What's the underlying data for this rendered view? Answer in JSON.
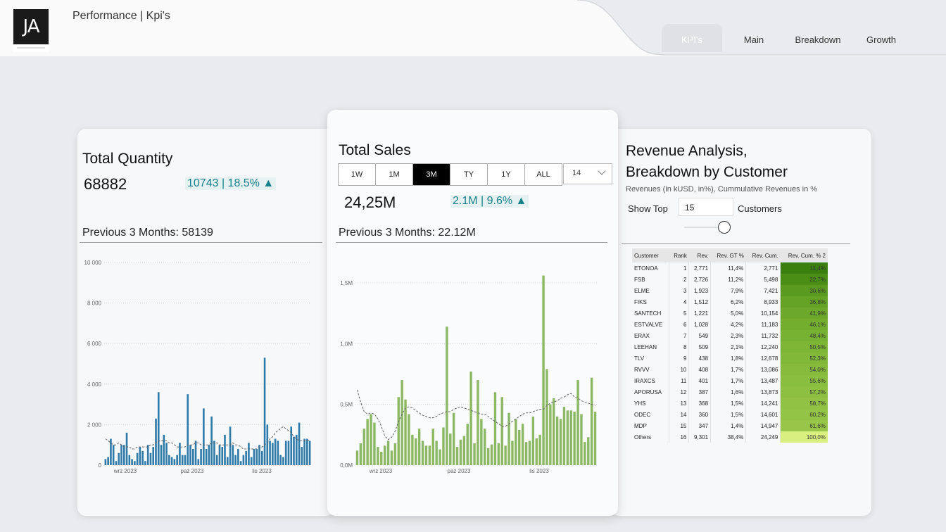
{
  "header": {
    "logo_text": "JA",
    "page_title": "Performance | Kpi's",
    "tabs": [
      {
        "label": "KPI's",
        "active": true
      },
      {
        "label": "Main",
        "active": false
      },
      {
        "label": "Breakdown",
        "active": false
      },
      {
        "label": "Growth",
        "active": false
      }
    ]
  },
  "quantity": {
    "title": "Total Quantity",
    "value": "68882",
    "delta": "10743 | 18.5% ▲",
    "previous": "Previous 3 Months: 58139"
  },
  "sales": {
    "title": "Total Sales",
    "periods": [
      {
        "label": "1W",
        "selected": false
      },
      {
        "label": "1M",
        "selected": false
      },
      {
        "label": "3M",
        "selected": true
      },
      {
        "label": "TY",
        "selected": false
      },
      {
        "label": "1Y",
        "selected": false
      },
      {
        "label": "ALL",
        "selected": false
      }
    ],
    "dropdown_value": "14",
    "value": "24,25M",
    "delta": "2.1M | 9.6% ▲",
    "previous": "Previous 3 Months: 22.12M"
  },
  "revenue": {
    "title_line1": "Revenue Analysis,",
    "title_line2": "Breakdown by Customer",
    "subtitle": "Revenues (in kUSD, in%), Cummulative Revenues in %",
    "show_top_label": "Show Top",
    "show_top_value": "15",
    "customers_label": "Customers",
    "slider_fraction": 0.9,
    "columns": [
      "Customer",
      "Rank",
      "Rev.",
      "Rev. GT %",
      "Rev. Cum.",
      "Rev. Cum. % 2"
    ],
    "rows": [
      [
        "ETONOA",
        "1",
        "2,771",
        "11,4%",
        "2,771",
        "11,4%"
      ],
      [
        "FSB",
        "2",
        "2,726",
        "11,2%",
        "5,498",
        "22,7%"
      ],
      [
        "ELME",
        "3",
        "1,923",
        "7,9%",
        "7,421",
        "30,6%"
      ],
      [
        "FIKS",
        "4",
        "1,512",
        "6,2%",
        "8,933",
        "36,8%"
      ],
      [
        "SANTECH",
        "5",
        "1,221",
        "5,0%",
        "10,154",
        "41,9%"
      ],
      [
        "ESTVALVE",
        "6",
        "1,028",
        "4,2%",
        "11,183",
        "46,1%"
      ],
      [
        "ERAX",
        "7",
        "549",
        "2,3%",
        "11,732",
        "48,4%"
      ],
      [
        "LEEHAN",
        "8",
        "509",
        "2,1%",
        "12,240",
        "50,5%"
      ],
      [
        "TLV",
        "9",
        "438",
        "1,8%",
        "12,678",
        "52,3%"
      ],
      [
        "RVVV",
        "10",
        "408",
        "1,7%",
        "13,086",
        "54,0%"
      ],
      [
        "IRAXCS",
        "11",
        "401",
        "1,7%",
        "13,487",
        "55,6%"
      ],
      [
        "APORUSA",
        "12",
        "387",
        "1,6%",
        "13,873",
        "57,2%"
      ],
      [
        "YHS",
        "13",
        "368",
        "1,5%",
        "14,241",
        "58,7%"
      ],
      [
        "ODEC",
        "14",
        "360",
        "1,5%",
        "14,601",
        "60,2%"
      ],
      [
        "MDP",
        "15",
        "347",
        "1,4%",
        "14,947",
        "61,6%"
      ],
      [
        "Others",
        "16",
        "9,301",
        "38,4%",
        "24,249",
        "100,0%"
      ]
    ],
    "cum_colors": [
      "#3b7f0e",
      "#4a8e15",
      "#5a9a1e",
      "#64a324",
      "#6ca92a",
      "#73ae2f",
      "#78b232",
      "#7db535",
      "#81b838",
      "#86bb3b",
      "#8abe3e",
      "#8dc041",
      "#91c244",
      "#94c446",
      "#97c648",
      "#d9ef7e"
    ]
  },
  "colors": {
    "quantity_bars": "#2e7aa8",
    "sales_bars": "#8cb865",
    "accent_delta": "#16808a"
  },
  "chart_data": [
    {
      "type": "bar",
      "title": "",
      "xlabel": "",
      "ylabel": "",
      "ylim": [
        0,
        10000
      ],
      "y_ticks": [
        "0",
        "2 000",
        "4 000",
        "6 000",
        "8 000",
        "10 000"
      ],
      "x_tick_labels": [
        "wrz 2023",
        "paź 2023",
        "lis 2023"
      ],
      "grid": true,
      "series": [
        {
          "values": [
            300,
            400,
            1300,
            1000,
            200,
            600,
            1000,
            1000,
            1600,
            500,
            300,
            200,
            600,
            900,
            700,
            200,
            1000,
            600,
            900,
            2300,
            3600,
            1000,
            1500,
            1100,
            500,
            400,
            300,
            500,
            1100,
            500,
            500,
            3500,
            1000,
            800,
            1200,
            300,
            800,
            2800,
            800,
            1000,
            2400,
            1200,
            500,
            1000,
            900,
            1500,
            400,
            1900,
            1000,
            500,
            800,
            200,
            500,
            700,
            1100,
            400,
            800,
            800,
            1000,
            700,
            5300,
            2000,
            1200,
            1100,
            1300,
            1200,
            500,
            400,
            1200,
            1200,
            1900,
            1400,
            1500,
            2100,
            900,
            1300,
            1300,
            1200
          ]
        },
        {
          "name": "",
          "type": "line",
          "dashed": true,
          "values": [
            1300,
            1200,
            1100,
            1000,
            1000,
            1100,
            1000,
            900,
            900,
            900,
            800,
            800,
            900,
            900,
            900,
            900,
            900,
            1000,
            1000,
            1100,
            1200,
            1200,
            1200,
            1200,
            1100,
            1100,
            1000,
            900,
            900,
            900,
            900,
            1000,
            1000,
            1000,
            1100,
            1100,
            1000,
            1000,
            1000,
            1000,
            1100,
            1100,
            1100,
            1000,
            1000,
            1000,
            1000,
            1000,
            1100,
            1000,
            1000,
            900,
            800,
            800,
            800,
            800,
            800,
            800,
            900,
            900,
            1000,
            1100,
            1300,
            1400,
            1600,
            1700,
            1800,
            1900,
            1800,
            1700,
            1600,
            1400,
            1300,
            1200,
            1200,
            1200,
            1200,
            1200
          ]
        }
      ]
    },
    {
      "type": "bar",
      "title": "",
      "xlabel": "",
      "ylabel": "",
      "ylim": [
        0,
        1650000
      ],
      "y_ticks": [
        "0,0M",
        "0,5M",
        "1,0M",
        "1,5M"
      ],
      "y_tick_values": [
        0,
        500000,
        1000000,
        1500000
      ],
      "x_tick_labels": [
        "wrz 2023",
        "paź 2023",
        "lis 2023"
      ],
      "grid": true,
      "series": [
        {
          "values": [
            120000,
            180000,
            300000,
            380000,
            420000,
            350000,
            150000,
            110000,
            160000,
            200000,
            120000,
            180000,
            560000,
            700000,
            540000,
            420000,
            250000,
            220000,
            300000,
            200000,
            160000,
            160000,
            300000,
            200000,
            130000,
            310000,
            1140000,
            260000,
            430000,
            150000,
            210000,
            240000,
            340000,
            770000,
            180000,
            700000,
            380000,
            300000,
            140000,
            170000,
            600000,
            180000,
            560000,
            160000,
            430000,
            200000,
            380000,
            290000,
            340000,
            190000,
            200000,
            400000,
            220000,
            250000,
            1560000,
            790000,
            500000,
            550000,
            400000,
            380000,
            480000,
            450000,
            450000,
            440000,
            700000,
            420000,
            190000,
            230000,
            720000,
            440000
          ]
        },
        {
          "name": "",
          "type": "line",
          "dashed": true,
          "values": [
            620000,
            520000,
            440000,
            420000,
            430000,
            420000,
            380000,
            320000,
            240000,
            210000,
            230000,
            280000,
            360000,
            420000,
            470000,
            480000,
            470000,
            450000,
            430000,
            410000,
            400000,
            390000,
            390000,
            400000,
            420000,
            430000,
            440000,
            440000,
            460000,
            470000,
            480000,
            470000,
            460000,
            450000,
            440000,
            430000,
            420000,
            420000,
            400000,
            380000,
            360000,
            340000,
            320000,
            320000,
            340000,
            360000,
            380000,
            400000,
            420000,
            430000,
            430000,
            440000,
            450000,
            460000,
            460000,
            490000,
            510000,
            520000,
            530000,
            550000,
            560000,
            580000,
            590000,
            560000,
            550000,
            530000,
            520000,
            510000,
            500000,
            490000
          ]
        }
      ]
    }
  ]
}
